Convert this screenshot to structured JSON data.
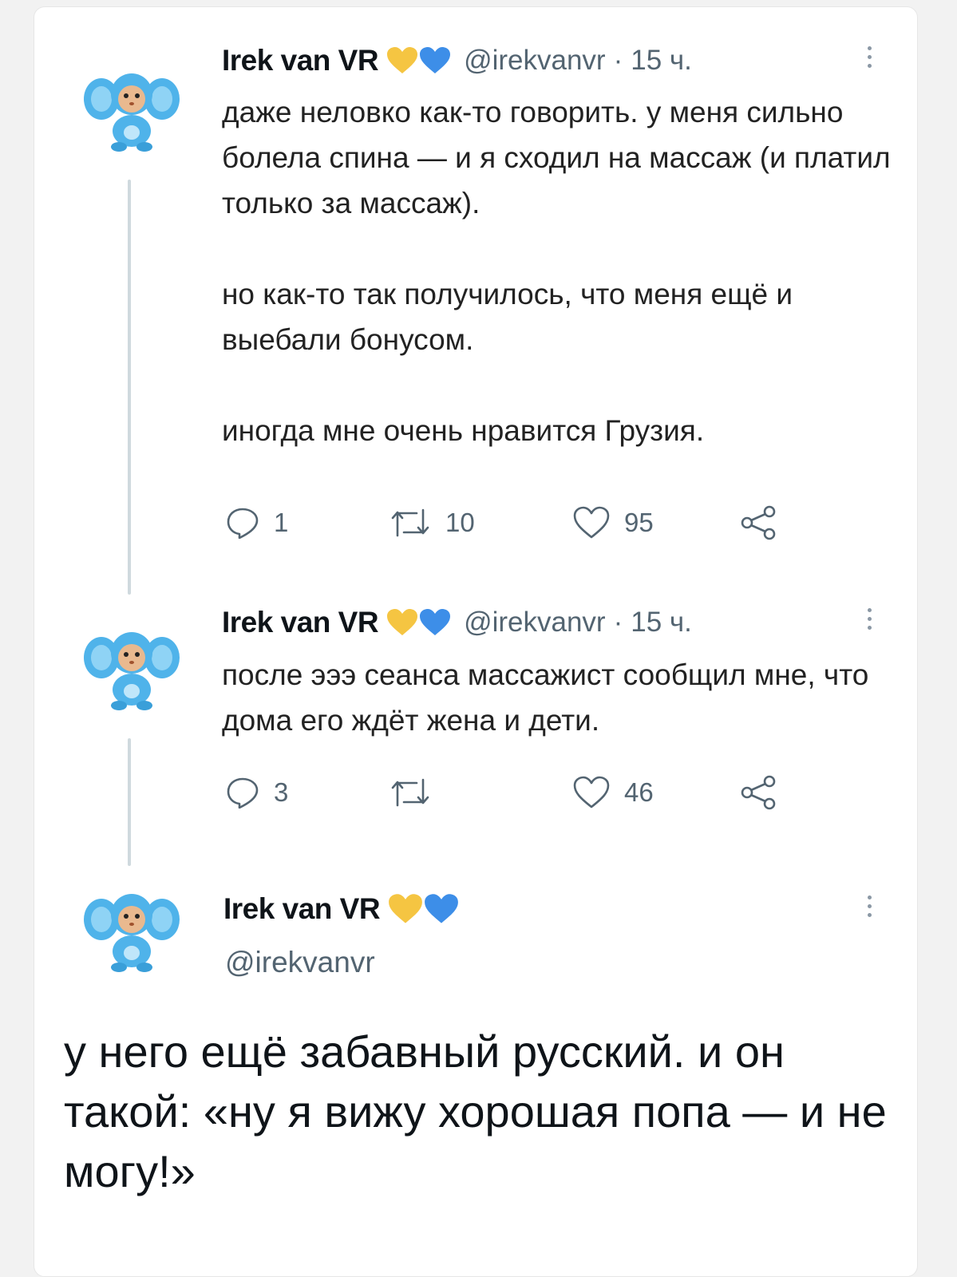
{
  "colors": {
    "accent_blue": "#4aa3e6",
    "heart_yellow": "#f5c542",
    "heart_blue": "#3d8ee8",
    "muted": "#536471",
    "thread_line": "#cfd9de"
  },
  "tweets": [
    {
      "name": "Irek van VR",
      "handle": "@irekvanvr",
      "separator": "·",
      "time": "15 ч.",
      "text": "даже неловко как-то говорить. у меня сильно болела спина — и я сходил на массаж (и платил только за массаж).\n\nно как-то так получилось, что меня ещё и выебали бонусом.\n\nиногда мне очень нравится Грузия.",
      "replies": "1",
      "retweets": "10",
      "likes": "95",
      "icons": [
        "reply-icon",
        "retweet-icon",
        "like-icon",
        "share-icon"
      ]
    },
    {
      "name": "Irek van VR",
      "handle": "@irekvanvr",
      "separator": "·",
      "time": "15 ч.",
      "text": "после эээ сеанса массажист сообщил мне, что дома его ждёт жена и дети.",
      "replies": "3",
      "retweets": "",
      "likes": "46",
      "icons": [
        "reply-icon",
        "retweet-icon",
        "like-icon",
        "share-icon"
      ]
    }
  ],
  "main_tweet": {
    "name": "Irek van VR",
    "handle": "@irekvanvr",
    "text": "у него ещё забавный русский. и он такой: «ну я вижу хорошая попа — и не могу!»"
  }
}
